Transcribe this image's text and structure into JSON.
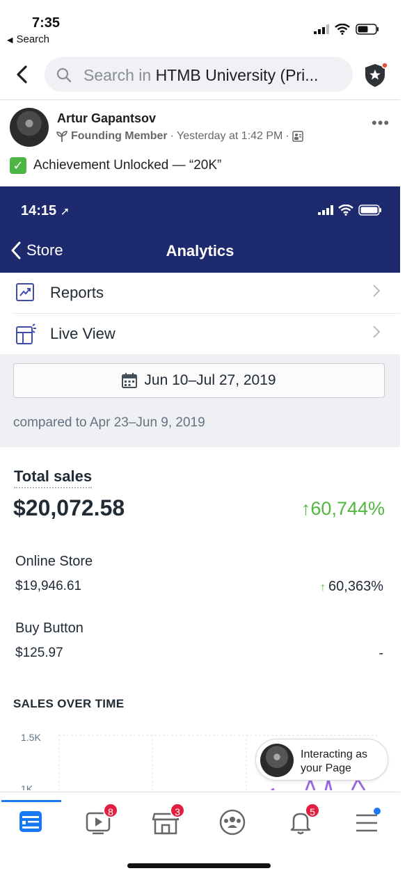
{
  "status_bar": {
    "time": "7:35",
    "back_label": "Search"
  },
  "header": {
    "search_prefix": "Search in ",
    "search_group": "HTMB University (Pri..."
  },
  "post": {
    "author": "Artur Gapantsov",
    "badge": "Founding Member",
    "separator": "·",
    "timestamp": "Yesterday at 1:42 PM",
    "text": "Achievement Unlocked — “20K”"
  },
  "screenshot": {
    "time": "14:15",
    "back_label": "Store",
    "title": "Analytics",
    "menu": [
      {
        "label": "Reports"
      },
      {
        "label": "Live View"
      }
    ],
    "date_range": "Jun 10–Jul 27, 2019",
    "compared": "compared to Apr 23–Jun 9, 2019",
    "total_sales": {
      "label": "Total sales",
      "value": "$20,072.58",
      "change": "60,744%",
      "arrow": "↑"
    },
    "breakdown": [
      {
        "label": "Online Store",
        "value": "$19,946.61",
        "change": "60,363%",
        "arrow": "↑"
      },
      {
        "label": "Buy Button",
        "value": "$125.97",
        "change": "-"
      }
    ],
    "chart": {
      "title": "SALES OVER TIME",
      "ticks": [
        "1.5K",
        "1K"
      ]
    }
  },
  "interacting": {
    "line1": "Interacting as",
    "line2": "your Page"
  },
  "tabs": [
    {
      "name": "news-feed",
      "badge": ""
    },
    {
      "name": "watch",
      "badge": "8"
    },
    {
      "name": "marketplace",
      "badge": "3"
    },
    {
      "name": "groups",
      "badge": ""
    },
    {
      "name": "notifications",
      "badge": "5"
    },
    {
      "name": "menu",
      "badge": ""
    }
  ],
  "colors": {
    "fb_blue": "#1877f2",
    "shopify_nav": "#1e2a6e",
    "positive_green": "#50b83c",
    "badge_red": "#e41e3f"
  }
}
